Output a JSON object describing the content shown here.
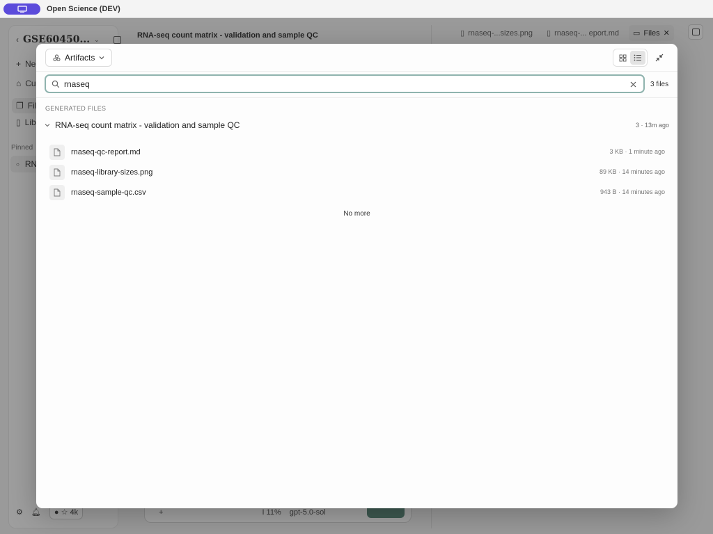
{
  "app": {
    "title": "Open Science (DEV)",
    "accent": "#5b4bdb"
  },
  "background": {
    "workspace_name": "GSE60450...",
    "nav": [
      "Ne",
      "Cu",
      "File",
      "Lib"
    ],
    "pinned_heading": "Pinned",
    "pinned_item": "RN",
    "github_stars": "4k",
    "thread_title": "RNA-seq count matrix - validation and sample QC",
    "tabs": [
      {
        "label": "rnaseq-...sizes.png"
      },
      {
        "label": "rnaseq-... eport.md"
      },
      {
        "label": "Files"
      }
    ],
    "composer": {
      "zoom": "I 11%",
      "model": "gpt-5.0-sol"
    }
  },
  "modal": {
    "source_label": "Artifacts",
    "search": {
      "value": "rnaseq",
      "file_count": "3 files"
    },
    "section_heading": "GENERATED FILES",
    "group": {
      "title": "RNA-seq count matrix - validation and sample QC",
      "meta": "3 · 13m ago"
    },
    "files": [
      {
        "name": "rnaseq-qc-report.md",
        "meta": "3 KB · 1 minute ago"
      },
      {
        "name": "rnaseq-library-sizes.png",
        "meta": "89 KB · 14 minutes ago"
      },
      {
        "name": "rnaseq-sample-qc.csv",
        "meta": "943 B · 14 minutes ago"
      }
    ],
    "footer_text": "No more"
  }
}
